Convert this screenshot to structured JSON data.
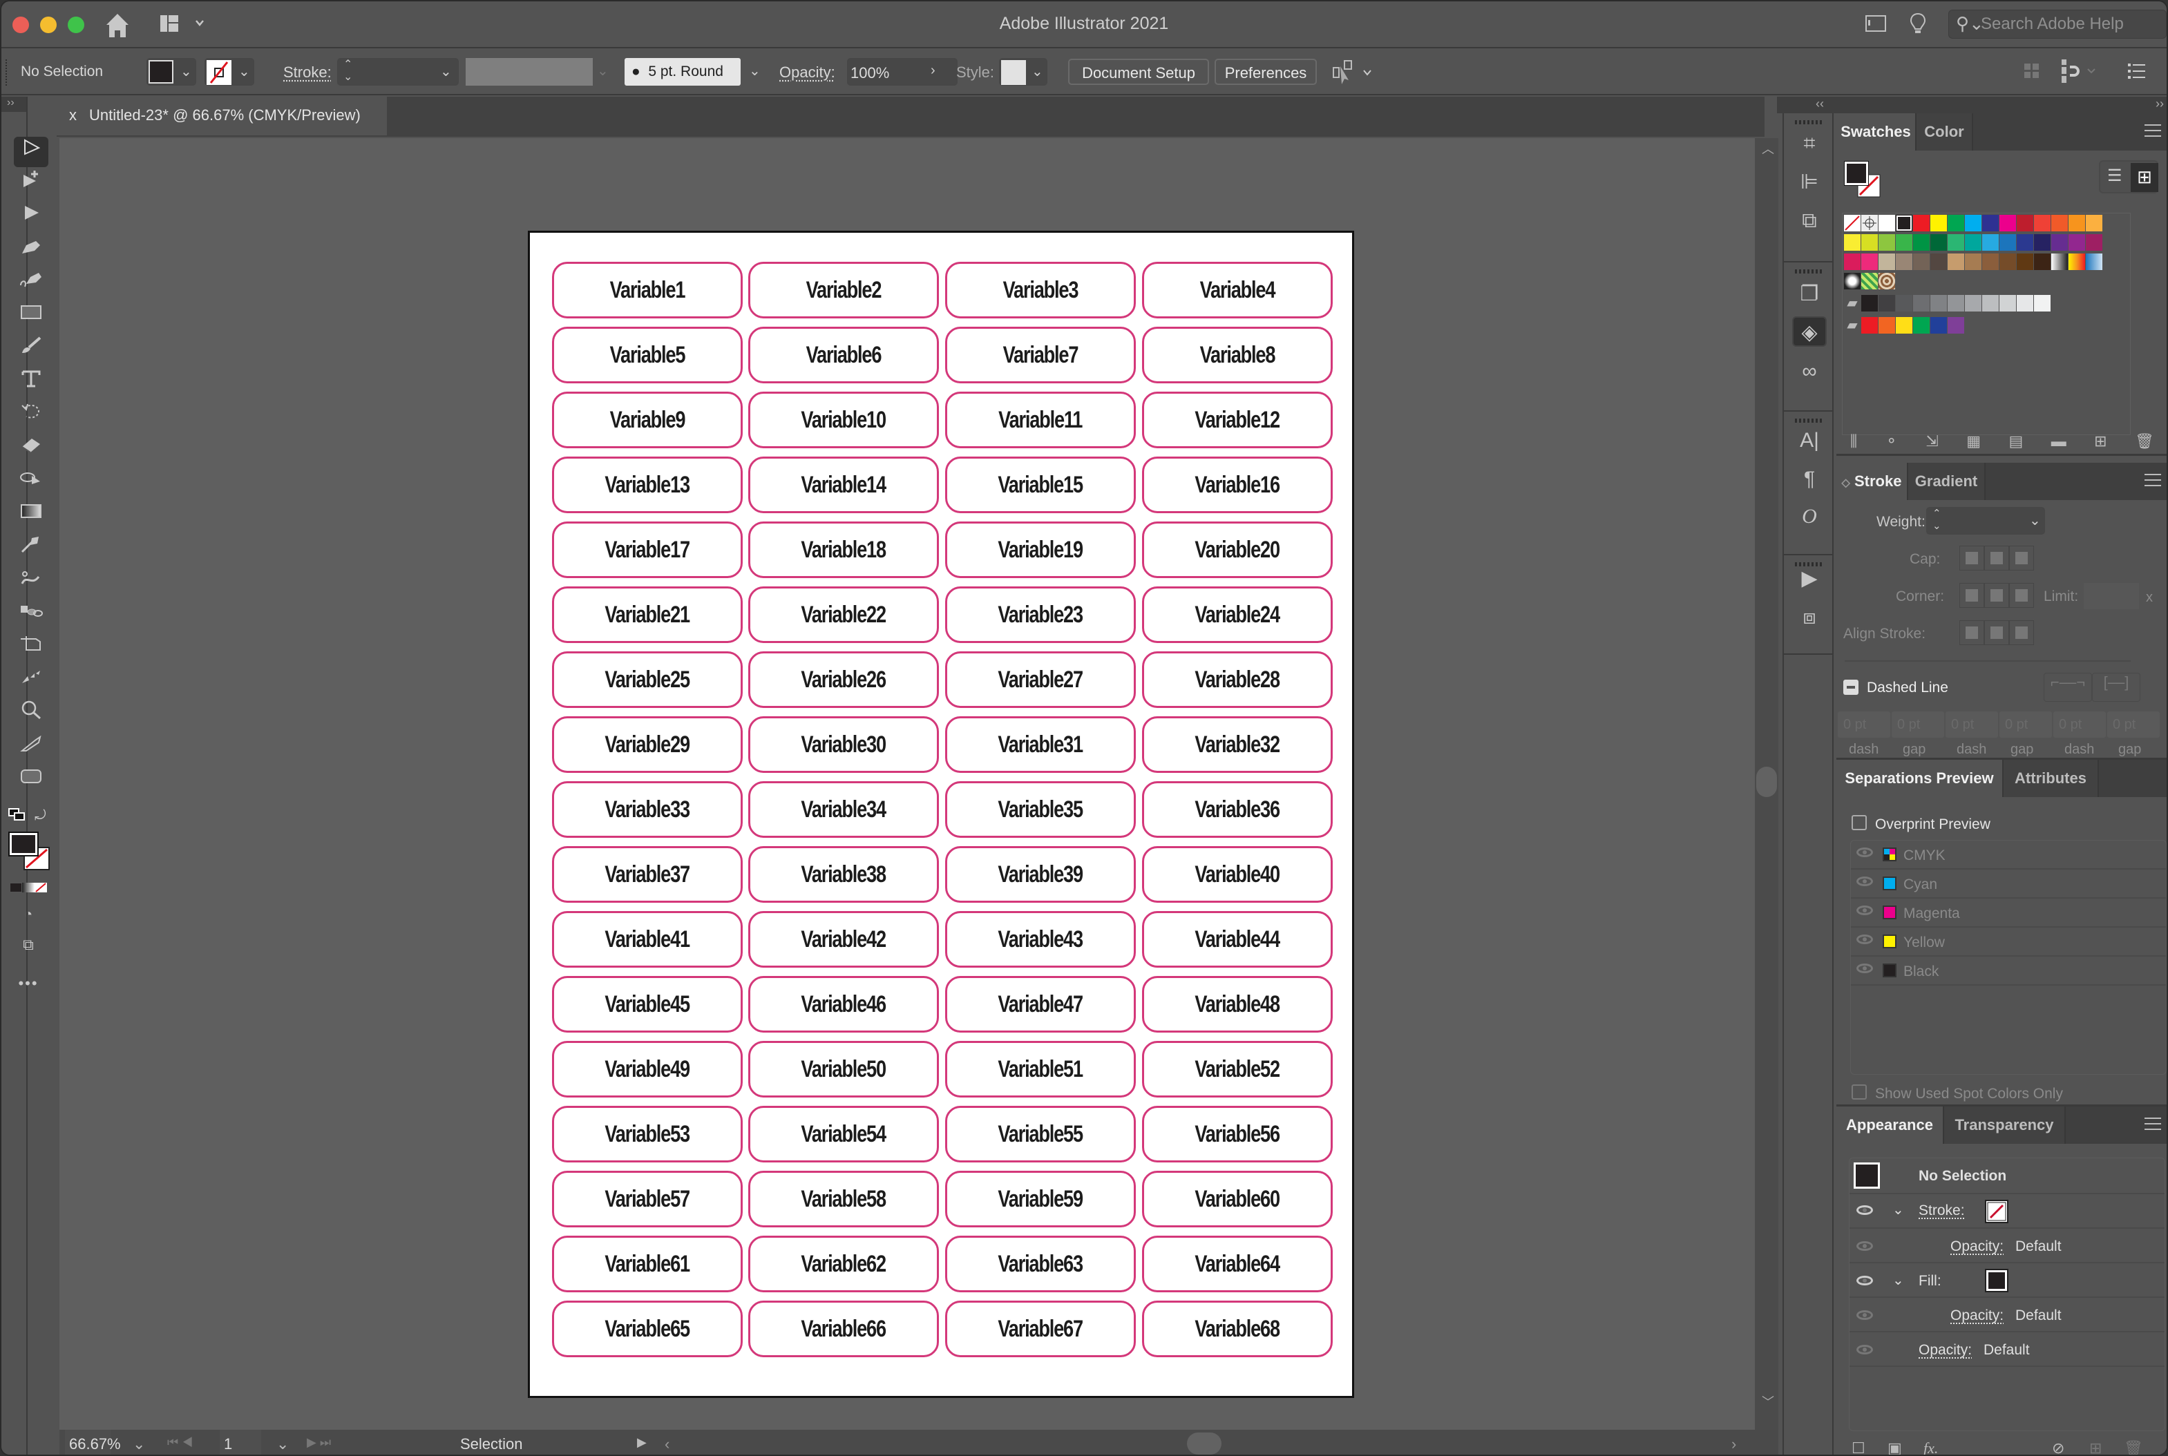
{
  "window": {
    "title": "Adobe Illustrator 2021",
    "search_placeholder": "Search Adobe Help"
  },
  "control_bar": {
    "selection_state": "No Selection",
    "fill_color": "#231f20",
    "stroke_label": "Stroke:",
    "stroke_value": "",
    "brush_label": "5 pt. Round",
    "opacity_label": "Opacity:",
    "opacity_value": "100%",
    "style_label": "Style:",
    "document_setup_label": "Document Setup",
    "preferences_label": "Preferences"
  },
  "document_tab": {
    "close_glyph": "x",
    "title": "Untitled-23* @ 66.67% (CMYK/Preview)"
  },
  "tools": [
    "selection-tool",
    "direct-selection-tool",
    "group-selection-tool",
    "pen-tool",
    "curvature-tool",
    "rectangle-tool",
    "paintbrush-tool",
    "type-tool",
    "rotate-tool",
    "eraser-tool",
    "shape-builder-tool",
    "gradient-tool",
    "eyedropper-tool",
    "puppet-warp-tool",
    "blend-tool",
    "artboard-tool",
    "width-tool",
    "zoom-tool",
    "knife-tool",
    "rounded-rectangle-tool"
  ],
  "artboard": {
    "label_stroke_color": "#d4387a",
    "labels": [
      "Variable1",
      "Variable2",
      "Variable3",
      "Variable4",
      "Variable5",
      "Variable6",
      "Variable7",
      "Variable8",
      "Variable9",
      "Variable10",
      "Variable11",
      "Variable12",
      "Variable13",
      "Variable14",
      "Variable15",
      "Variable16",
      "Variable17",
      "Variable18",
      "Variable19",
      "Variable20",
      "Variable21",
      "Variable22",
      "Variable23",
      "Variable24",
      "Variable25",
      "Variable26",
      "Variable27",
      "Variable28",
      "Variable29",
      "Variable30",
      "Variable31",
      "Variable32",
      "Variable33",
      "Variable34",
      "Variable35",
      "Variable36",
      "Variable37",
      "Variable38",
      "Variable39",
      "Variable40",
      "Variable41",
      "Variable42",
      "Variable43",
      "Variable44",
      "Variable45",
      "Variable46",
      "Variable47",
      "Variable48",
      "Variable49",
      "Variable50",
      "Variable51",
      "Variable52",
      "Variable53",
      "Variable54",
      "Variable55",
      "Variable56",
      "Variable57",
      "Variable58",
      "Variable59",
      "Variable60",
      "Variable61",
      "Variable62",
      "Variable63",
      "Variable64",
      "Variable65",
      "Variable66",
      "Variable67",
      "Variable68"
    ]
  },
  "status_bar": {
    "zoom": "66.67%",
    "artboard_number": "1",
    "current_tool": "Selection"
  },
  "swatches_panel": {
    "tabs": [
      "Swatches",
      "Color"
    ],
    "row1": [
      "#ffffff",
      "#231f20",
      "#ed1c24",
      "#fff200",
      "#00a651",
      "#00aeef",
      "#2e3192",
      "#ec008c",
      "#be1e2d",
      "#ef4136",
      "#f15a29",
      "#f7941d",
      "#fbb040"
    ],
    "row2": [
      "#f9ed32",
      "#d7df23",
      "#8dc63f",
      "#39b54a",
      "#009444",
      "#006838",
      "#2bb673",
      "#00a79d",
      "#27aae1",
      "#1c75bc",
      "#2b3990",
      "#262262",
      "#662d91",
      "#92278f",
      "#9e1f63"
    ],
    "row3": [
      "#da1c5c",
      "#ee2a7b",
      "#c2b59b",
      "#998675",
      "#736357",
      "#534741",
      "#c69c6d",
      "#a67c52",
      "#8b5e3c",
      "#754c29",
      "#603913",
      "#3c2415"
    ],
    "gray_group": [
      "#231f20",
      "#414042",
      "#58595b",
      "#6d6e71",
      "#808285",
      "#939598",
      "#a7a9ac",
      "#bcbec0",
      "#d1d3d4",
      "#e6e7e8",
      "#f1f2f2"
    ],
    "bright_group": [
      "#ed1c24",
      "#f26522",
      "#ffde17",
      "#00a651",
      "#21409a",
      "#7f3f98"
    ]
  },
  "stroke_panel": {
    "tabs": [
      "Stroke",
      "Gradient"
    ],
    "weight_label": "Weight:",
    "cap_label": "Cap:",
    "corner_label": "Corner:",
    "limit_label": "Limit:",
    "limit_suffix": "x",
    "align_label": "Align Stroke:",
    "dashed_line_label": "Dashed Line",
    "dash_fields": [
      {
        "value": "0 pt",
        "label": "dash"
      },
      {
        "value": "0 pt",
        "label": "gap"
      },
      {
        "value": "0 pt",
        "label": "dash"
      },
      {
        "value": "0 pt",
        "label": "gap"
      },
      {
        "value": "0 pt",
        "label": "dash"
      },
      {
        "value": "0 pt",
        "label": "gap"
      }
    ]
  },
  "separations_panel": {
    "tabs": [
      "Separations Preview",
      "Attributes"
    ],
    "overprint_label": "Overprint Preview",
    "plates": [
      {
        "name": "CMYK",
        "color": "mixed"
      },
      {
        "name": "Cyan",
        "color": "#00aeef"
      },
      {
        "name": "Magenta",
        "color": "#ec008c"
      },
      {
        "name": "Yellow",
        "color": "#fff200"
      },
      {
        "name": "Black",
        "color": "#231f20"
      }
    ],
    "spot_only_label": "Show Used Spot Colors Only"
  },
  "appearance_panel": {
    "tabs": [
      "Appearance",
      "Transparency"
    ],
    "header": "No Selection",
    "stroke_label": "Stroke:",
    "fill_label": "Fill:",
    "opacity_label": "Opacity:",
    "opacity_value": "Default"
  }
}
